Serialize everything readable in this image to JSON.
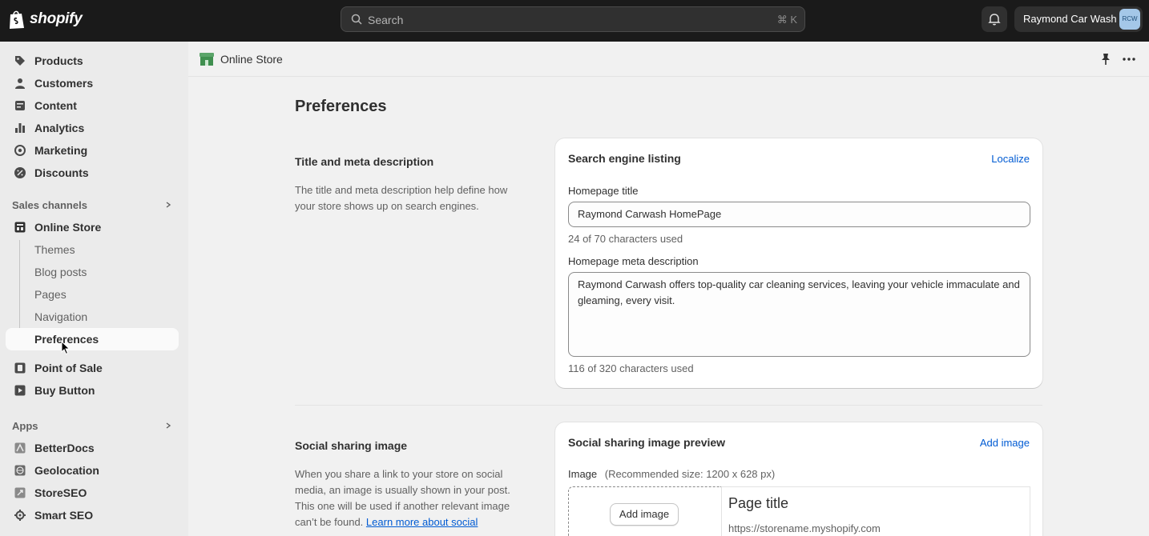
{
  "topbar": {
    "logo_text": "shopify",
    "search_placeholder": "Search",
    "search_shortcut": "⌘ K",
    "store_name": "Raymond Car Wash",
    "avatar_initials": "RCW"
  },
  "sidebar": {
    "items": [
      {
        "label": "Products",
        "icon": "tag-icon"
      },
      {
        "label": "Customers",
        "icon": "person-icon"
      },
      {
        "label": "Content",
        "icon": "content-icon"
      },
      {
        "label": "Analytics",
        "icon": "bar-chart-icon"
      },
      {
        "label": "Marketing",
        "icon": "target-icon"
      },
      {
        "label": "Discounts",
        "icon": "discount-icon"
      }
    ],
    "sales_channels_label": "Sales channels",
    "online_store": {
      "label": "Online Store",
      "icon": "store-icon"
    },
    "online_store_sub": [
      {
        "label": "Themes"
      },
      {
        "label": "Blog posts"
      },
      {
        "label": "Pages"
      },
      {
        "label": "Navigation"
      },
      {
        "label": "Preferences",
        "active": true
      }
    ],
    "channels": [
      {
        "label": "Point of Sale",
        "icon": "pos-icon"
      },
      {
        "label": "Buy Button",
        "icon": "buy-button-icon"
      }
    ],
    "apps_label": "Apps",
    "apps": [
      {
        "label": "BetterDocs",
        "icon": "betterdocs-icon"
      },
      {
        "label": "Geolocation",
        "icon": "globe-icon"
      },
      {
        "label": "StoreSEO",
        "icon": "storeseo-icon"
      },
      {
        "label": "Smart SEO",
        "icon": "gear-icon"
      }
    ]
  },
  "pagebar": {
    "title": "Online Store"
  },
  "main": {
    "page_title": "Preferences",
    "title_meta": {
      "heading": "Title and meta description",
      "description": "The title and meta description help define how your store shows up on search engines."
    },
    "search_listing_card": {
      "title": "Search engine listing",
      "localize_link": "Localize",
      "homepage_title_label": "Homepage title",
      "homepage_title_value": "Raymond Carwash HomePage",
      "homepage_title_help": "24 of 70 characters used",
      "meta_desc_label": "Homepage meta description",
      "meta_desc_value": "Raymond Carwash offers top-quality car cleaning services, leaving your vehicle immaculate and gleaming, every visit.",
      "meta_desc_help": "116 of 320 characters used"
    },
    "social_sharing": {
      "heading": "Social sharing image",
      "description": "When you share a link to your store on social media, an image is usually shown in your post. This one will be used if another relevant image can’t be found.",
      "learn_more_link": "Learn more about social"
    },
    "social_preview_card": {
      "title": "Social sharing image preview",
      "add_image_link": "Add image",
      "image_label": "Image",
      "image_hint": "(Recommended size: 1200 x 628 px)",
      "add_image_button": "Add image",
      "preview_title": "Page title",
      "preview_url": "https://storename.myshopify.com"
    }
  }
}
